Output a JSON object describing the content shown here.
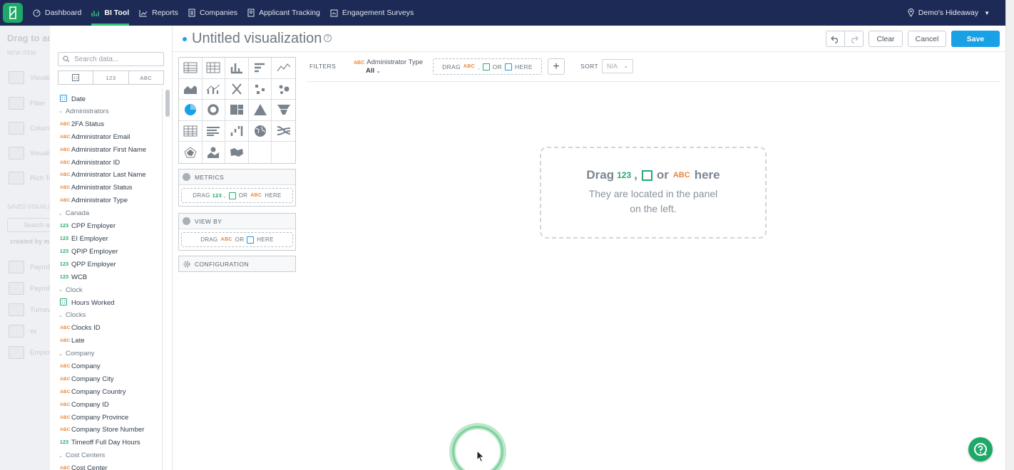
{
  "nav": {
    "items": [
      {
        "label": "Dashboard",
        "icon": "dashboard-icon"
      },
      {
        "label": "BI Tool",
        "icon": "bi-chart-icon",
        "active": true
      },
      {
        "label": "Reports",
        "icon": "reports-icon"
      },
      {
        "label": "Companies",
        "icon": "building-icon"
      },
      {
        "label": "Applicant Tracking",
        "icon": "applicant-icon"
      },
      {
        "label": "Engagement Surveys",
        "icon": "survey-icon"
      }
    ],
    "location": "Demo's Hideaway",
    "accent_color": "#2ec27e",
    "bar_color": "#1c2a55"
  },
  "background_page": {
    "title": "Drag to add",
    "new_item": "NEW ITEM",
    "items": [
      "Visualization",
      "Filter",
      "Column",
      "Visualization",
      "Rich Text"
    ],
    "saved_label": "SAVED VISUALIZATIONS",
    "search_placeholder": "Search all",
    "created_by": "created by me",
    "saved_items": [
      "Payroll",
      "Payroll",
      "Turnover",
      "xx",
      "Employees"
    ]
  },
  "data_panel": {
    "search_placeholder": "Search data...",
    "type_tabs": [
      "date",
      "123",
      "ABC"
    ],
    "fields": [
      {
        "kind": "field",
        "type": "date",
        "label": "Date"
      },
      {
        "kind": "group",
        "label": "Administrators"
      },
      {
        "kind": "field",
        "type": "ABC",
        "label": "2FA Status"
      },
      {
        "kind": "field",
        "type": "ABC",
        "label": "Administrator Email"
      },
      {
        "kind": "field",
        "type": "ABC",
        "label": "Administrator First Name"
      },
      {
        "kind": "field",
        "type": "ABC",
        "label": "Administrator ID"
      },
      {
        "kind": "field",
        "type": "ABC",
        "label": "Administrator Last Name"
      },
      {
        "kind": "field",
        "type": "ABC",
        "label": "Administrator Status"
      },
      {
        "kind": "field",
        "type": "ABC",
        "label": "Administrator Type"
      },
      {
        "kind": "group",
        "label": "Canada"
      },
      {
        "kind": "field",
        "type": "123",
        "label": "CPP Employer"
      },
      {
        "kind": "field",
        "type": "123",
        "label": "EI Employer"
      },
      {
        "kind": "field",
        "type": "123",
        "label": "QPIP Employer"
      },
      {
        "kind": "field",
        "type": "123",
        "label": "QPP Employer"
      },
      {
        "kind": "field",
        "type": "123",
        "label": "WCB"
      },
      {
        "kind": "group",
        "label": "Clock"
      },
      {
        "kind": "field",
        "type": "date",
        "label": "Hours Worked"
      },
      {
        "kind": "group",
        "label": "Clocks"
      },
      {
        "kind": "field",
        "type": "ABC",
        "label": "Clocks ID"
      },
      {
        "kind": "field",
        "type": "ABC",
        "label": "Late"
      },
      {
        "kind": "group",
        "label": "Company"
      },
      {
        "kind": "field",
        "type": "ABC",
        "label": "Company"
      },
      {
        "kind": "field",
        "type": "ABC",
        "label": "Company City"
      },
      {
        "kind": "field",
        "type": "ABC",
        "label": "Company Country"
      },
      {
        "kind": "field",
        "type": "ABC",
        "label": "Company ID"
      },
      {
        "kind": "field",
        "type": "ABC",
        "label": "Company Province"
      },
      {
        "kind": "field",
        "type": "ABC",
        "label": "Company Store Number"
      },
      {
        "kind": "field",
        "type": "123",
        "label": "Timeoff Full Day Hours"
      },
      {
        "kind": "group",
        "label": "Cost Centers"
      },
      {
        "kind": "field",
        "type": "ABC",
        "label": "Cost Center"
      }
    ]
  },
  "header": {
    "title": "Untitled visualization",
    "help": "?",
    "undo_icon": "undo-icon",
    "redo_icon": "redo-icon",
    "clear_label": "Clear",
    "cancel_label": "Cancel",
    "save_label": "Save",
    "save_color": "#1aa0e4"
  },
  "sections": {
    "metrics": "METRICS",
    "view_by": "VIEW BY",
    "configuration": "CONFIGURATION",
    "drag": "DRAG",
    "or": "OR",
    "here": "HERE",
    "abc": "ABC",
    "num": "123"
  },
  "filters": {
    "label": "FILTERS",
    "chip_name": "Administrator Type",
    "chip_value": "All",
    "sort_label": "SORT",
    "sort_value": "N/A"
  },
  "canvas": {
    "drag": "Drag",
    "or": "or",
    "here": "here",
    "sub_line1": "They are located in the panel",
    "sub_line2": "on the left."
  }
}
